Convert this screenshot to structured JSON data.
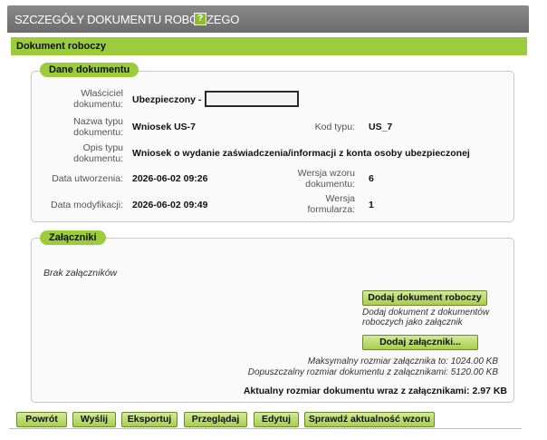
{
  "window": {
    "title": "SZCZEGÓŁY DOKUMENTU ROBOCZEGO",
    "help_label": "?",
    "accent_color": "#9ccc3c"
  },
  "section": {
    "title": "Dokument roboczy"
  },
  "dane": {
    "legend": "Dane dokumentu",
    "owner": {
      "label_line1": "Właściciel",
      "label_line2": "dokumentu:",
      "value": "Ubezpieczony -",
      "field_value": ""
    },
    "type_name": {
      "label_line1": "Nazwa typu",
      "label_line2": "dokumentu:",
      "value": "Wniosek US-7"
    },
    "type_code": {
      "label": "Kod typu:",
      "value": "US_7"
    },
    "type_desc": {
      "label_line1": "Opis typu",
      "label_line2": "dokumentu:",
      "value": "Wniosek o wydanie zaświadczenia/informacji z konta osoby ubezpieczonej"
    },
    "created": {
      "label": "Data utworzenia:",
      "value": "2026-06-02 09:26"
    },
    "template_version": {
      "label_line1": "Wersja wzoru",
      "label_line2": "dokumentu:",
      "value": "6"
    },
    "modified": {
      "label": "Data modyfikacji:",
      "value": "2026-06-02 09:49"
    },
    "form_version": {
      "label_line1": "Wersja",
      "label_line2": "formularza:",
      "value": "1"
    }
  },
  "zalaczniki": {
    "legend": "Załączniki",
    "empty_text": "Brak załączników",
    "add_draft_button": "Dodaj dokument roboczy",
    "add_draft_hint_line1": "Dodaj dokument z dokumentów",
    "add_draft_hint_line2": "roboczych jako załącznik",
    "add_attachments_button": "Dodaj załączniki...",
    "max_attachment": "Maksymalny rozmiar załącznika to: 1024.00 KB",
    "max_document": "Dopuszczalny rozmiar dokumentu z załącznikami: 5120.00 KB",
    "current_size": "Aktualny rozmiar dokumentu wraz z załącznikami: 2.97 KB"
  },
  "buttons": {
    "back": "Powrót",
    "send": "Wyślij",
    "export": "Eksportuj",
    "preview": "Przeglądaj",
    "edit": "Edytuj",
    "check": "Sprawdź aktualność wzoru"
  }
}
